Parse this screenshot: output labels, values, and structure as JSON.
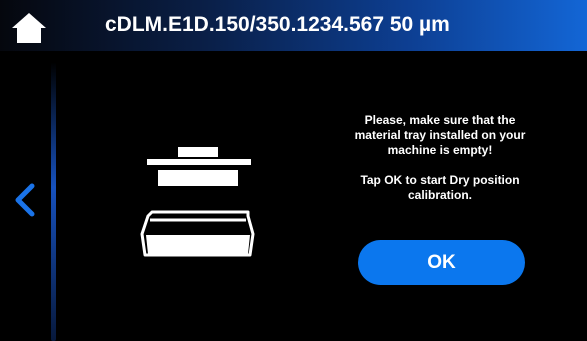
{
  "header": {
    "title": "cDLM.E1D.150/350.1234.567 50 µm",
    "home_icon": "home-icon"
  },
  "navigation": {
    "back_icon": "chevron-left-icon"
  },
  "illustration": {
    "icon": "empty-material-tray-icon"
  },
  "message": {
    "line1": "Please, make sure that the material tray installed on your machine is empty!",
    "line2": "Tap OK to start Dry position calibration."
  },
  "ok_button": {
    "label": "OK"
  },
  "colors": {
    "background": "#000000",
    "accent": "#0b77ee",
    "header_gradient_end": "#1366d6",
    "text": "#ffffff"
  }
}
